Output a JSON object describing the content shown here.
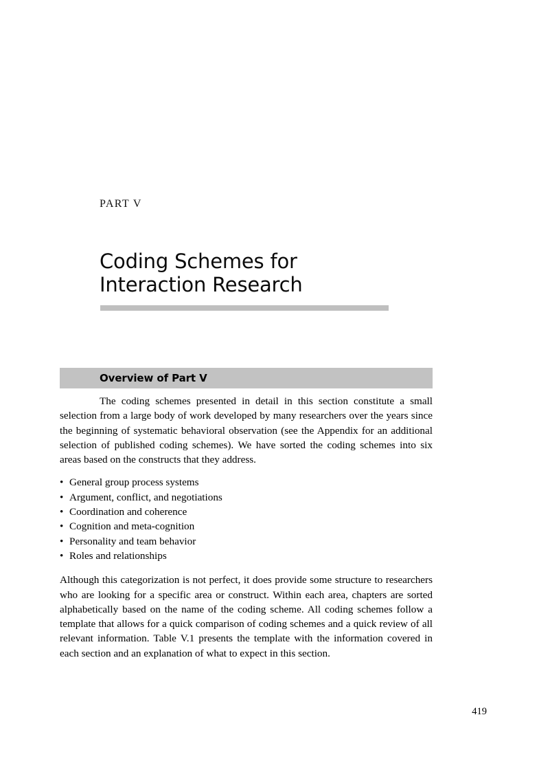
{
  "page": {
    "part_label": "PART V",
    "part_title": "Coding Schemes for Interaction Research",
    "folio": "419",
    "band_color": "#c2c2c2",
    "rule_color": "#bfbfbf"
  },
  "overview": {
    "heading": "Overview of Part V",
    "paragraph_1": "The coding schemes presented in detail in this section constitute a small selection from a large body of work developed by many researchers over the years since the beginning of systematic behavioral observation (see the Appendix for an additional selection of published coding schemes). We have sorted the coding schemes into six areas based on the constructs that they address.",
    "bullets": [
      "General group process systems",
      "Argument, conflict, and negotiations",
      "Coordination and coherence",
      "Cognition and meta-cognition",
      "Personality and team behavior",
      "Roles and relationships"
    ],
    "bullet_marker": "•",
    "paragraph_2": "Although this categorization is not perfect, it does provide some structure to researchers who are looking for a specific area or construct. Within each area, chapters are sorted alphabetically based on the name of the coding scheme. All coding schemes follow a template that allows for a quick comparison of coding schemes and a quick review of all relevant information. Table V.1 presents the template with the information covered in each section and an explanation of what to expect in this section."
  }
}
